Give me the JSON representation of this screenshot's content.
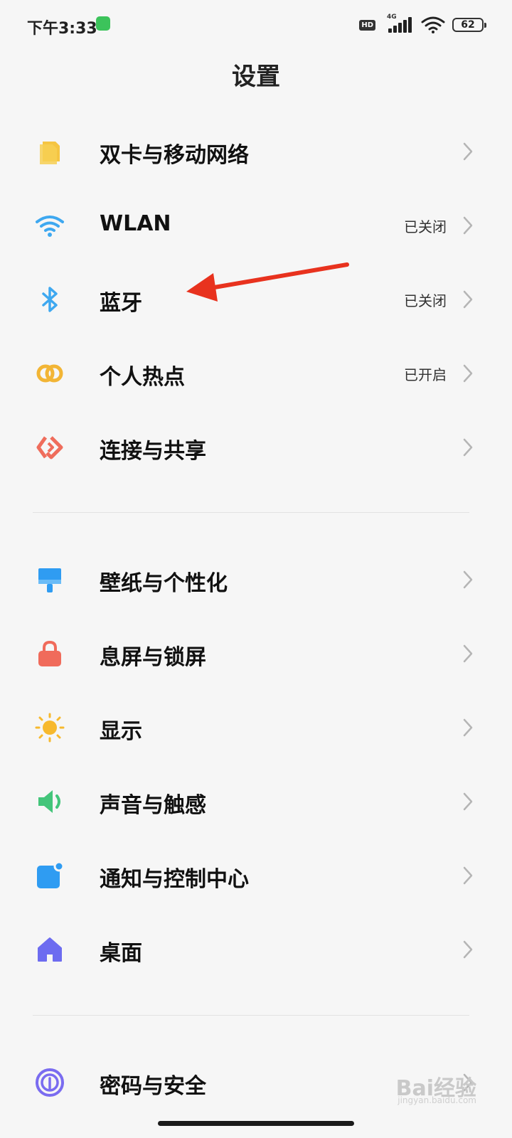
{
  "status_bar": {
    "time": "下午3:33",
    "network": "4G",
    "hd": "HD",
    "battery": "62"
  },
  "title": "设置",
  "groups": [
    {
      "items": [
        {
          "label": "双卡与移动网络",
          "status": "",
          "icon": "sim-card-icon",
          "color": "#f5c542"
        },
        {
          "label": "WLAN",
          "status": "已关闭",
          "icon": "wifi-icon",
          "color": "#3ea8f0"
        },
        {
          "label": "蓝牙",
          "status": "已关闭",
          "icon": "bluetooth-icon",
          "color": "#3ea8f0"
        },
        {
          "label": "个人热点",
          "status": "已开启",
          "icon": "hotspot-icon",
          "color": "#f2b535"
        },
        {
          "label": "连接与共享",
          "status": "",
          "icon": "share-icon",
          "color": "#ef6d5c"
        }
      ]
    },
    {
      "items": [
        {
          "label": "壁纸与个性化",
          "status": "",
          "icon": "wallpaper-icon",
          "color": "#2f9cf2"
        },
        {
          "label": "息屏与锁屏",
          "status": "",
          "icon": "lock-icon",
          "color": "#f06b5b"
        },
        {
          "label": "显示",
          "status": "",
          "icon": "sun-icon",
          "color": "#f7b92e"
        },
        {
          "label": "声音与触感",
          "status": "",
          "icon": "speaker-icon",
          "color": "#43c57a"
        },
        {
          "label": "通知与控制中心",
          "status": "",
          "icon": "notification-icon",
          "color": "#2f9cf2"
        },
        {
          "label": "桌面",
          "status": "",
          "icon": "home-icon",
          "color": "#6d6cf0"
        }
      ]
    },
    {
      "items": [
        {
          "label": "密码与安全",
          "status": "",
          "icon": "fingerprint-icon",
          "color": "#7a6cf0"
        }
      ]
    }
  ],
  "annotation_color": "#e8321e",
  "watermark": "Bai经验",
  "watermark_sub": "jingyan.baidu.com"
}
